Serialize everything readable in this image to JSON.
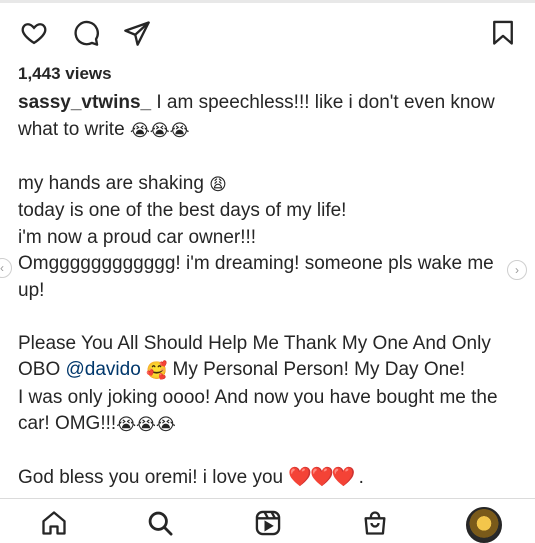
{
  "post": {
    "views": "1,443 views",
    "username": "sassy_vtwins_",
    "caption_lines": [
      " I am speechless!!! like i don't even know",
      "what to write",
      "my hands are shaking",
      "today is one of the best days of my life!",
      "i'm now a proud car owner!!!",
      "Omgggggggggggg! i'm dreaming! someone pls wake me",
      "up!",
      "Please You All Should Help Me Thank My One And Only",
      "OBO ",
      "@davido",
      " My Personal Person! My Day One!",
      "I was only joking oooo! And now you have bought me the",
      "car! OMG!!!",
      "God bless you oremi! i love you",
      " ."
    ],
    "emojis": {
      "crying_triple": "😭😭😭",
      "weary": "😩",
      "smiling_hearts": "🥰",
      "hearts": "❤️❤️❤️"
    }
  },
  "icons": {
    "like": "heart-outline-icon",
    "comment": "comment-bubble-icon",
    "share": "paper-plane-icon",
    "save": "bookmark-icon",
    "home": "home-icon",
    "search": "search-icon",
    "reels": "reels-icon",
    "shop": "shopping-bag-icon"
  },
  "colors": {
    "text": "#262626",
    "mention": "#00376b",
    "heart": "#e0243a"
  }
}
